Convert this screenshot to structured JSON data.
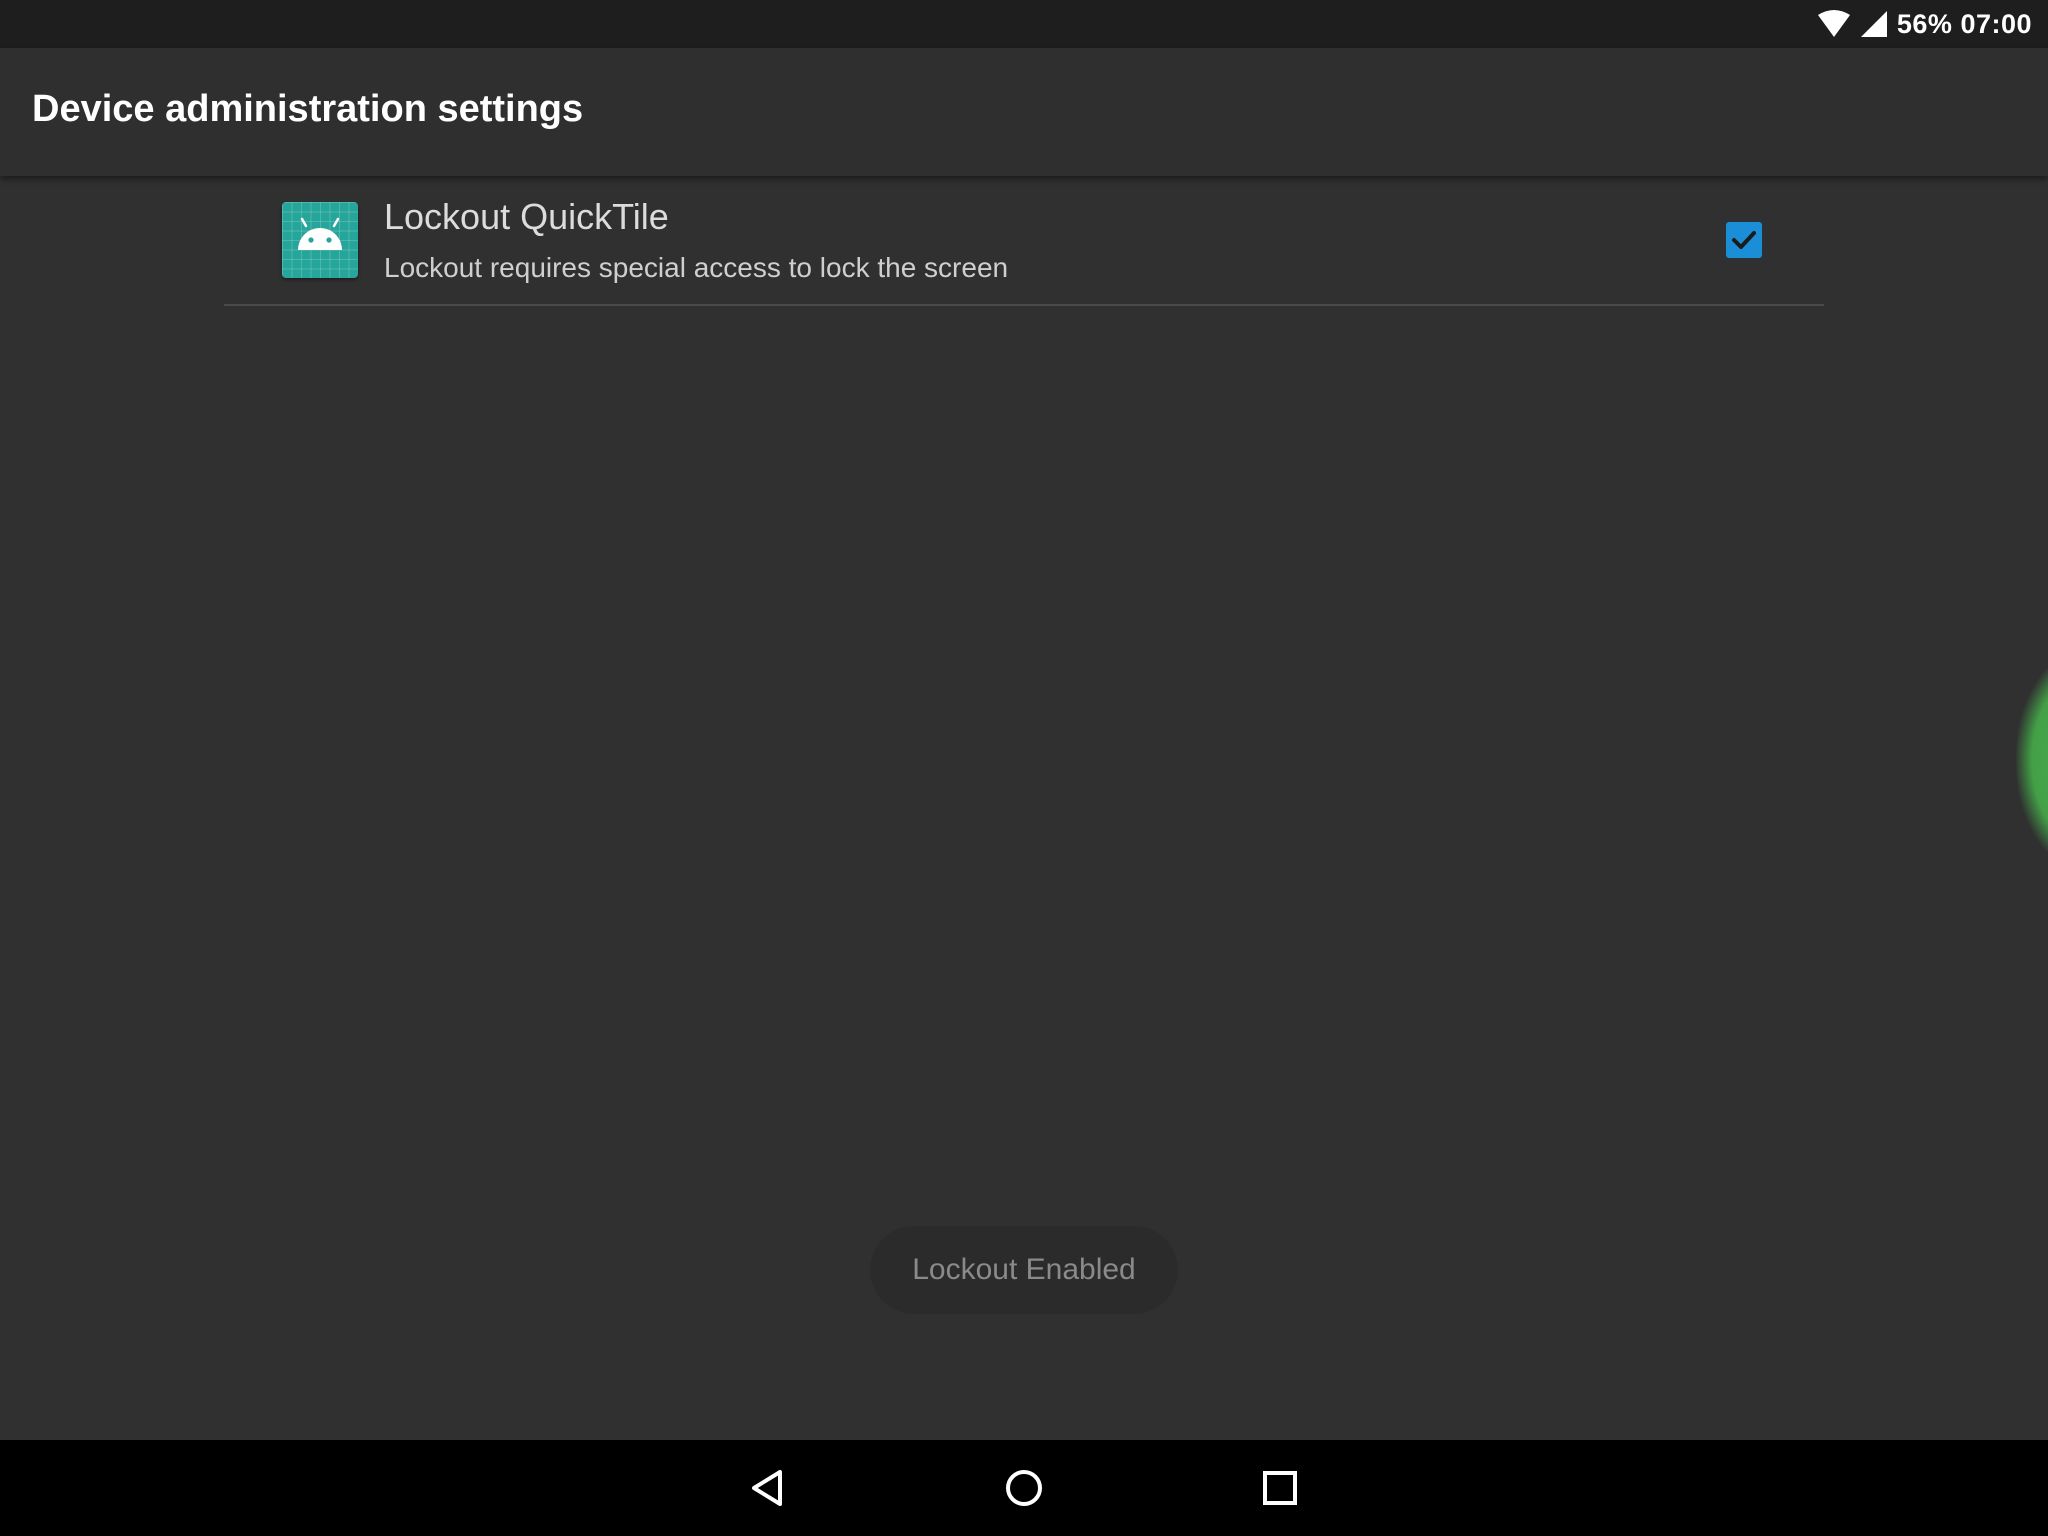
{
  "status_bar": {
    "battery": "56%",
    "time": "07:00",
    "icons": [
      "wifi-icon",
      "cell-signal-icon"
    ]
  },
  "app_bar": {
    "title": "Device administration settings"
  },
  "admin_item": {
    "icon": "android-app-icon",
    "title": "Lockout QuickTile",
    "subtitle": "Lockout requires special access to lock the screen",
    "checked": true
  },
  "toast": {
    "text": "Lockout Enabled"
  },
  "nav_bar": {
    "buttons": [
      "back-icon",
      "home-icon",
      "recents-icon"
    ]
  },
  "colors": {
    "background": "#303030",
    "status_bar": "#1e1e1e",
    "app_bar": "#2f2f2f",
    "accent": "#1a8fd8",
    "app_icon": "#26a69a",
    "edge_glow": "#4caf50"
  }
}
